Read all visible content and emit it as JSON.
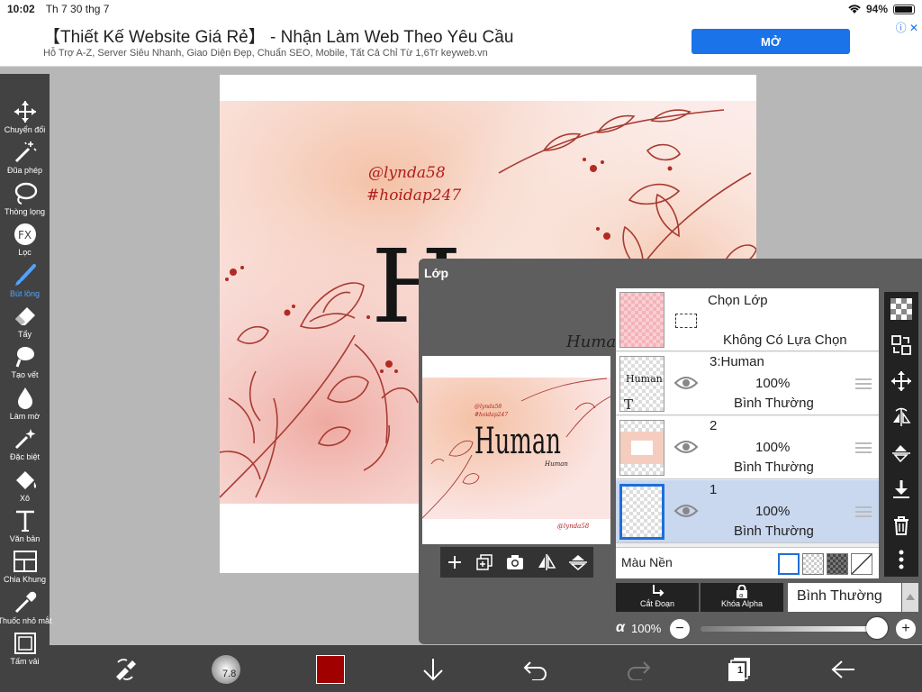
{
  "status": {
    "time": "10:02",
    "date": "Th 7 30 thg 7",
    "battery": "94%",
    "battery_level": 0.94
  },
  "ad": {
    "title": "【Thiết Kế Website Giá Rẻ】 - Nhận Làm Web Theo Yêu Cầu",
    "subtitle": "Hỗ Trợ A-Z, Server Siêu Nhanh, Giao Diện Đẹp, Chuẩn SEO, Mobile, Tất Cả Chỉ Từ 1,6Tr keyweb.vn",
    "button": "MỞ"
  },
  "tools": [
    {
      "label": "Chuyển đổi",
      "icon": "move-icon"
    },
    {
      "label": "Đũa phép",
      "icon": "magic-wand-icon"
    },
    {
      "label": "Thòng lọng",
      "icon": "lasso-icon"
    },
    {
      "label": "Lọc",
      "icon": "fx-icon"
    },
    {
      "label": "Bút lông",
      "icon": "brush-icon"
    },
    {
      "label": "Tẩy",
      "icon": "eraser-icon"
    },
    {
      "label": "Tạo vết",
      "icon": "smudge-icon"
    },
    {
      "label": "Làm mờ",
      "icon": "blur-icon"
    },
    {
      "label": "Đặc biệt",
      "icon": "special-icon"
    },
    {
      "label": "Xô",
      "icon": "bucket-icon"
    },
    {
      "label": "Văn bản",
      "icon": "text-icon"
    },
    {
      "label": "Chia Khung",
      "icon": "frame-icon"
    },
    {
      "label": "Thuốc nhỏ mắt",
      "icon": "eyedropper-icon"
    },
    {
      "label": "Tấm vải",
      "icon": "canvas-icon"
    }
  ],
  "active_tool": "Bút lông",
  "artwork": {
    "title_word": "Human",
    "subtitle_word": "Human",
    "tag1": "@lynda58",
    "tag2": "#hoidap247",
    "preview_signature": "@lynda58"
  },
  "layer_panel": {
    "title": "Lớp",
    "selection": {
      "title": "Chọn Lớp",
      "desc": "Không Có Lựa Chọn"
    },
    "layers": [
      {
        "name": "3:Human",
        "opacity": "100%",
        "mode": "Bình Thường",
        "thumb_text": "Human",
        "thumb_badge": "T"
      },
      {
        "name": "2",
        "opacity": "100%",
        "mode": "Bình Thường"
      },
      {
        "name": "1",
        "opacity": "100%",
        "mode": "Bình Thường"
      }
    ],
    "background_label": "Màu Nền",
    "cut_label": "Cắt Đoạn",
    "lock_label": "Khóa Alpha",
    "blend_mode": "Bình Thường",
    "alpha_symbol": "α",
    "alpha_value": "100%",
    "alpha_level": 1.0
  },
  "bottom": {
    "brush_size": "7.8",
    "color": "#a00000",
    "page_count": "1"
  }
}
